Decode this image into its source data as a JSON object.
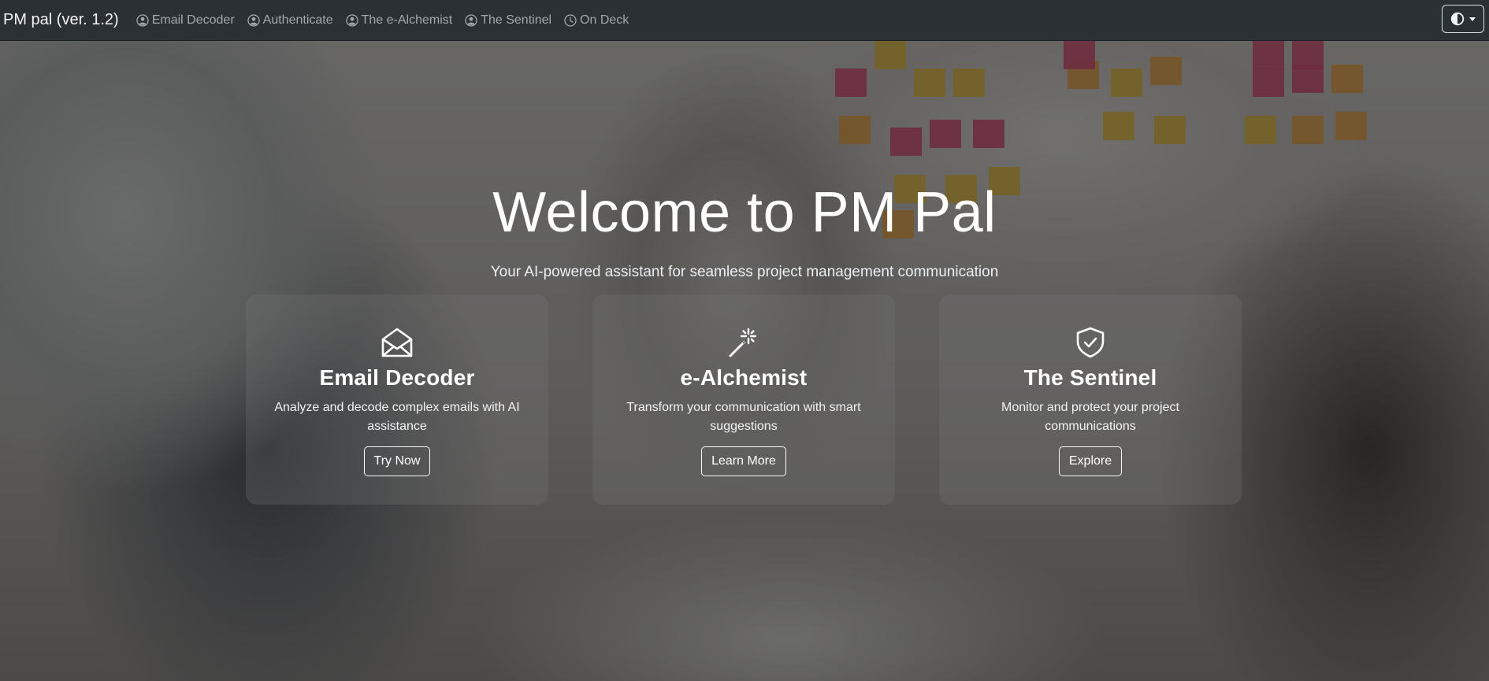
{
  "navbar": {
    "brand": "PM pal (ver. 1.2)",
    "links": [
      {
        "label": "Email Decoder",
        "icon": "user-circle-icon"
      },
      {
        "label": "Authenticate",
        "icon": "user-circle-icon"
      },
      {
        "label": "The e-Alchemist",
        "icon": "user-circle-icon"
      },
      {
        "label": "The Sentinel",
        "icon": "user-circle-icon"
      },
      {
        "label": "On Deck",
        "icon": "clock-icon"
      }
    ],
    "theme_toggle_icon": "contrast-half-circle-icon"
  },
  "hero": {
    "title": "Welcome to PM Pal",
    "subtitle": "Your AI-powered assistant for seamless project management communication"
  },
  "cards": [
    {
      "icon": "envelope-open-icon",
      "title": "Email Decoder",
      "text": "Analyze and decode complex emails with AI assistance",
      "button": "Try Now"
    },
    {
      "icon": "magic-wand-icon",
      "title": "e-Alchemist",
      "text": "Transform your communication with smart suggestions",
      "button": "Learn More"
    },
    {
      "icon": "shield-check-icon",
      "title": "The Sentinel",
      "text": "Monitor and protect your project communications",
      "button": "Explore"
    }
  ],
  "colors": {
    "navbar_bg": "#2b3035",
    "nav_link": "#a3a8ae",
    "text": "#ffffff",
    "card_bg": "rgba(120,120,120,0.28)"
  }
}
